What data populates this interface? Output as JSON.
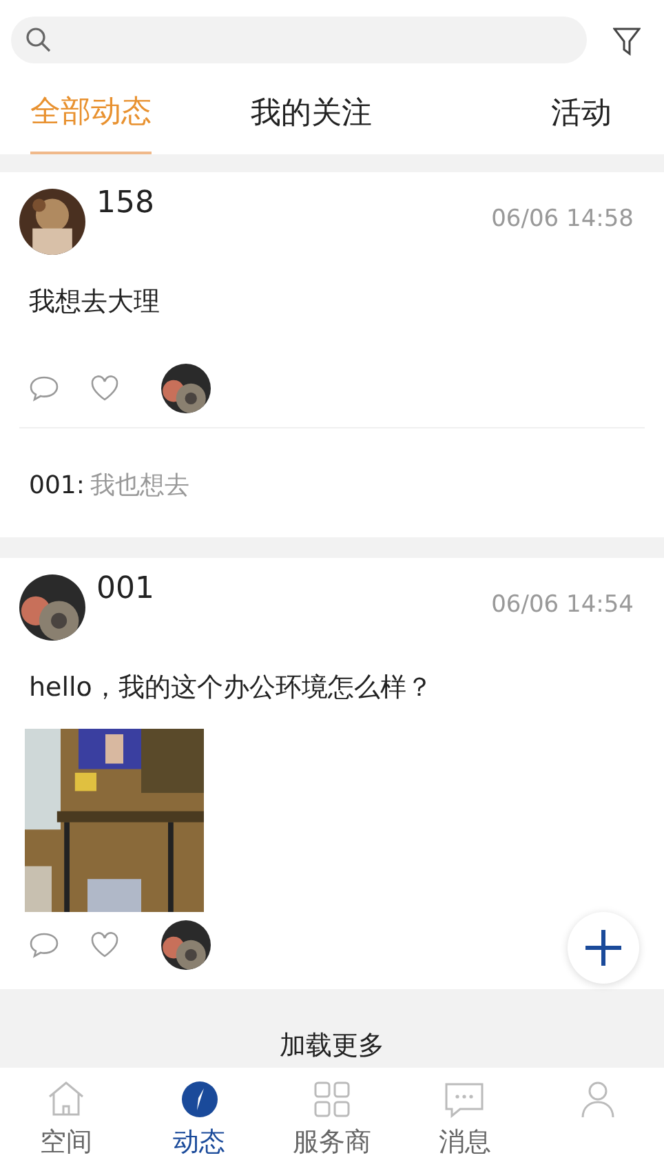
{
  "tabs": [
    {
      "label": "全部动态",
      "selected": true
    },
    {
      "label": "我的关注",
      "selected": false
    },
    {
      "label": "活动",
      "selected": false
    }
  ],
  "posts": [
    {
      "author": "158",
      "time": "06/06 14:58",
      "text": "我想去大理",
      "comments": [
        {
          "author": "001:",
          "text": "我也想去"
        }
      ]
    },
    {
      "author": "001",
      "time": "06/06 14:54",
      "text": "hello，我的这个办公环境怎么样？"
    }
  ],
  "load_more": "加载更多",
  "nav": [
    {
      "label": "空间",
      "kind": "home",
      "selected": false
    },
    {
      "label": "动态",
      "kind": "compass",
      "selected": true
    },
    {
      "label": "服务商",
      "kind": "grid",
      "selected": false
    },
    {
      "label": "消息",
      "kind": "chat",
      "selected": false
    },
    {
      "kind": "person",
      "selected": false
    }
  ]
}
